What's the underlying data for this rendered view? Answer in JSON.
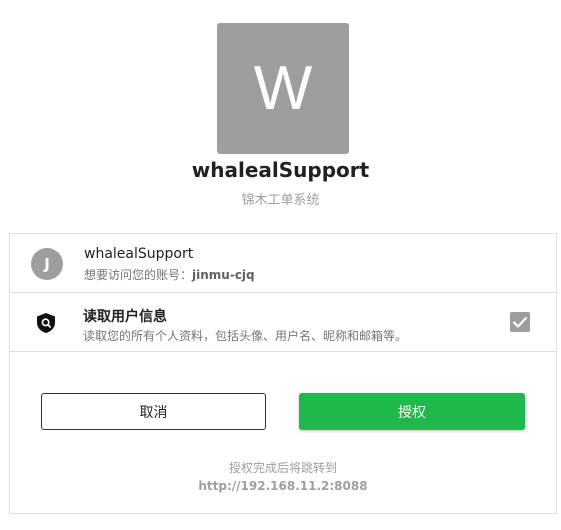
{
  "app": {
    "logo_letter": "W",
    "name": "whalealSupport",
    "subtitle": "锦木工单系统"
  },
  "account": {
    "avatar_letter": "J",
    "client_name": "whalealSupport",
    "access_prefix": "想要访问您的账号：",
    "username": "jinmu-cjq"
  },
  "permission": {
    "icon": "shield-icon",
    "title": "读取用户信息",
    "description": "读取您的所有个人资料，包括头像、用户名、昵称和邮箱等。",
    "checked": true
  },
  "buttons": {
    "cancel_label": "取消",
    "authorize_label": "授权"
  },
  "redirect": {
    "note": "授权完成后将跳转到",
    "url": "http://192.168.11.2:8088"
  },
  "colors": {
    "primary": "#1eb94a",
    "logo_bg": "#9e9e9e",
    "muted_text": "#9e9e9e"
  }
}
